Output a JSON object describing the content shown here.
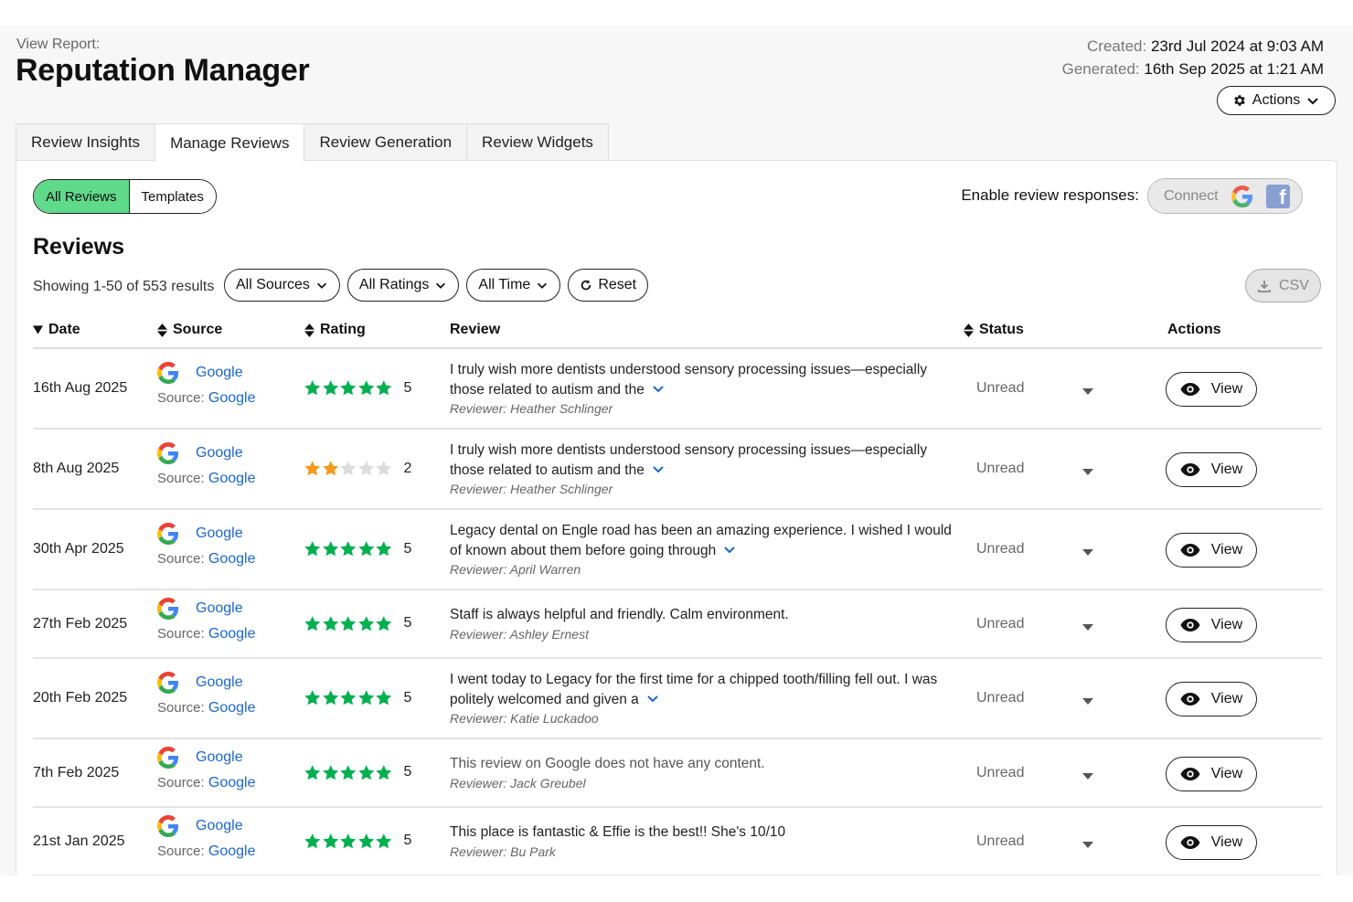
{
  "header": {
    "view_report_label": "View Report:",
    "title": "Reputation Manager",
    "created_label": "Created:",
    "created_value": "23rd Jul 2024 at 9:03 AM",
    "generated_label": "Generated:",
    "generated_value": "16th Sep 2025 at 1:21 AM",
    "actions_label": "Actions"
  },
  "tabs": [
    {
      "label": "Review Insights",
      "active": false
    },
    {
      "label": "Manage Reviews",
      "active": true
    },
    {
      "label": "Review Generation",
      "active": false
    },
    {
      "label": "Review Widgets",
      "active": false
    }
  ],
  "segment": {
    "all_reviews": "All Reviews",
    "templates": "Templates"
  },
  "responses": {
    "enable_label": "Enable review responses:",
    "connect_label": "Connect"
  },
  "reviews": {
    "heading": "Reviews",
    "showing": "Showing 1-50 of 553 results",
    "filters": {
      "sources": "All Sources",
      "ratings": "All Ratings",
      "time": "All Time",
      "reset": "Reset"
    },
    "csv_label": "CSV",
    "columns": {
      "date": "Date",
      "source": "Source",
      "rating": "Rating",
      "review": "Review",
      "status": "Status",
      "actions": "Actions"
    }
  },
  "colors": {
    "accent_green": "#5fd98a",
    "star_green": "#00b04f",
    "star_orange": "#f59a1c",
    "star_empty": "#dcdcdc",
    "link_blue": "#1a66d2"
  },
  "rows": [
    {
      "date": "16th Aug 2025",
      "source": "Google",
      "source_prefix": "Source:",
      "source_link": "Google",
      "rating": 5,
      "rating_text": "5",
      "review": "I truly wish more dentists understood sensory processing issues—especially those related to autism and the",
      "expandable": true,
      "muted": false,
      "reviewer": "Reviewer: Heather Schlinger",
      "status": "Unread",
      "action": "View"
    },
    {
      "date": "8th Aug 2025",
      "source": "Google",
      "source_prefix": "Source:",
      "source_link": "Google",
      "rating": 2,
      "rating_text": "2",
      "review": "I truly wish more dentists understood sensory processing issues—especially those related to autism and the",
      "expandable": true,
      "muted": false,
      "reviewer": "Reviewer: Heather Schlinger",
      "status": "Unread",
      "action": "View"
    },
    {
      "date": "30th Apr 2025",
      "source": "Google",
      "source_prefix": "Source:",
      "source_link": "Google",
      "rating": 5,
      "rating_text": "5",
      "review": "Legacy dental on Engle road has been an amazing experience. I wished I would of known about them before going through",
      "expandable": true,
      "muted": false,
      "reviewer": "Reviewer: April Warren",
      "status": "Unread",
      "action": "View"
    },
    {
      "date": "27th Feb 2025",
      "source": "Google",
      "source_prefix": "Source:",
      "source_link": "Google",
      "rating": 5,
      "rating_text": "5",
      "review": "Staff is always helpful and friendly. Calm environment.",
      "expandable": false,
      "muted": false,
      "reviewer": "Reviewer: Ashley Ernest",
      "status": "Unread",
      "action": "View"
    },
    {
      "date": "20th Feb 2025",
      "source": "Google",
      "source_prefix": "Source:",
      "source_link": "Google",
      "rating": 5,
      "rating_text": "5",
      "review": "I went today to Legacy for the first time for a chipped tooth/filling fell out. I was politely welcomed and given a",
      "expandable": true,
      "muted": false,
      "reviewer": "Reviewer: Katie Luckadoo",
      "status": "Unread",
      "action": "View"
    },
    {
      "date": "7th Feb 2025",
      "source": "Google",
      "source_prefix": "Source:",
      "source_link": "Google",
      "rating": 5,
      "rating_text": "5",
      "review": "This review on Google does not have any content.",
      "expandable": false,
      "muted": true,
      "reviewer": "Reviewer: Jack Greubel",
      "status": "Unread",
      "action": "View"
    },
    {
      "date": "21st Jan 2025",
      "source": "Google",
      "source_prefix": "Source:",
      "source_link": "Google",
      "rating": 5,
      "rating_text": "5",
      "review": "This place is fantastic & Effie is the best!! She's 10/10",
      "expandable": false,
      "muted": false,
      "reviewer": "Reviewer: Bu Park",
      "status": "Unread",
      "action": "View"
    }
  ]
}
